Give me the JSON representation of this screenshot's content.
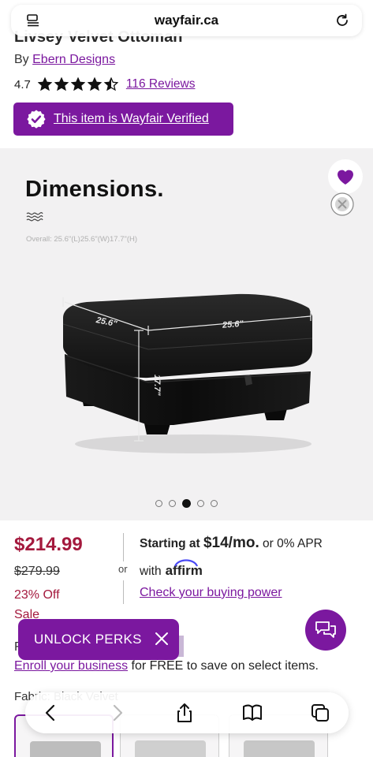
{
  "browser": {
    "url": "wayfair.ca"
  },
  "product": {
    "title": "Livsey Velvet Ottoman",
    "by_prefix": "By",
    "brand": "Ebern Designs",
    "rating": "4.7",
    "stars_filled": 4.5,
    "reviews": "116 Reviews",
    "verified": "This item is Wayfair Verified"
  },
  "gallery": {
    "heading": "Dimensions.",
    "overall": "Overall: 25.6\"(L)25.6\"(W)17.7\"(H)",
    "length_label": "25.6\"",
    "width_label": "25.6\"",
    "height_label": "17.7\"",
    "slide_index": 3,
    "slide_count": 5
  },
  "pricing": {
    "price": "$214.99",
    "old_price": "$279.99",
    "discount": "23% Off",
    "sale": "Sale",
    "or": "or",
    "starting_at": "Starting at",
    "monthly": "$14/mo.",
    "apr": "or 0% APR",
    "with": "with",
    "affirm": "affirm",
    "check_power": "Check your buying power"
  },
  "promo": {
    "unlock": "UNLOCK PERKS",
    "f_letter": "F",
    "enroll_link": "Enroll your business",
    "enroll_rest": " for FREE to save on select items."
  },
  "options": {
    "fabric_label": "Fabric: Black Velvet"
  },
  "colors": {
    "accent": "#7b189f",
    "price_red": "#a4193d"
  }
}
